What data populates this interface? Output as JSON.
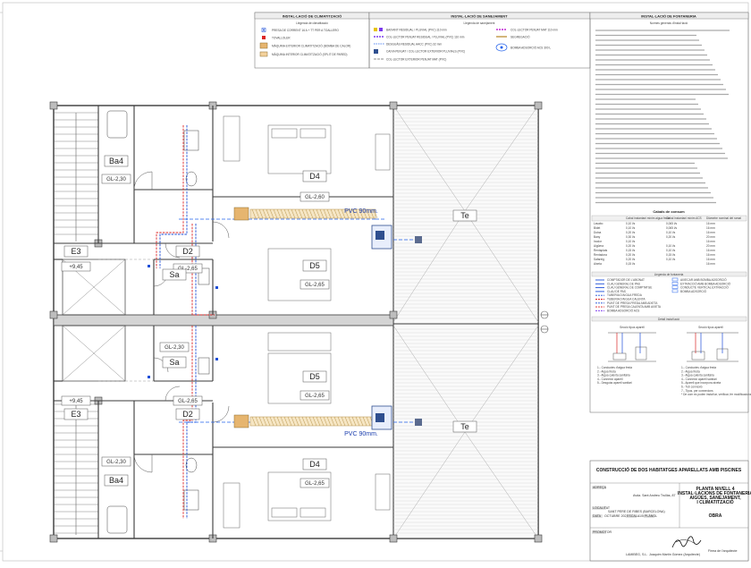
{
  "legend_panels": {
    "climate": {
      "title": "INSTAL·LACIÓ DE CLIMATITZACIÓ",
      "subtitle": "Llegenda de climatització",
      "items": [
        "PRESA DE CORRENT 16 A + TT PER A TOALLERO",
        "TOVALLOLER",
        "MÀQUINA EXTERIOR CLIMATITZACIÓ (BOMBA DE CALOR)",
        "MÀQUINA INTERIOR CLIMATITZACIÓ (SPLIT DE PARED)"
      ]
    },
    "sanitation": {
      "title": "INSTAL·LACIÓ DE SANEJAMENT",
      "subtitle": "Llegenda de sanejament",
      "items_left": [
        "BAIXANT RESIDUAL / PLUVIAL (PVC) 110 mm",
        "COL·LECTOR PENJAT RESIDUAL / PLUVIAL (PVC) 110 mm",
        "DESGUÀS RESIDUAL AACC (PVC) 32 mm",
        "CAIXA PENJAT / COL·LECTOR EXTERIOR PLUVIALS (PVC)",
        "COL·LECTOR EXTERIOR PENJAT MAT (PVC)"
      ],
      "items_right": [
        "COL·LECTOR PENJAT MAT 110 mm",
        "SEGREGACIÓ",
        "BOMBA ADSORCIÓ ACS 300 L"
      ]
    },
    "plumbing": {
      "title": "INSTAL·LACIÓ DE FONTANERIA",
      "subtitle": "Normes generals d'instal·lació",
      "flow_title": "Cabals de consum",
      "flow_headers": [
        "",
        "Cabal instantani mínim aigua freda",
        "Cabal instantani mínim ACS",
        "Diàmetre nominal del ramal"
      ],
      "flow_rows": [
        [
          "Lavabo",
          "0,10 l/s",
          "0,065 l/s",
          "16 mm"
        ],
        [
          "Bidet",
          "0,10 l/s",
          "0,065 l/s",
          "16 mm"
        ],
        [
          "Dutxa",
          "0,20 l/s",
          "0,10 l/s",
          "16 mm"
        ],
        [
          "Bany",
          "0,30 l/s",
          "0,20 l/s",
          "20 mm"
        ],
        [
          "Inodor",
          "0,10 l/s",
          "",
          "16 mm"
        ],
        [
          "Aigüera",
          "0,20 l/s",
          "0,10 l/s",
          "20 mm"
        ],
        [
          "Rentaplats",
          "0,15 l/s",
          "0,10 l/s",
          "16 mm"
        ],
        [
          "Rentadora",
          "0,20 l/s",
          "0,15 l/s",
          "16 mm"
        ],
        [
          "Safareig",
          "0,20 l/s",
          "0,10 l/s",
          "16 mm"
        ],
        [
          "Aixeta",
          "0,15 l/s",
          "",
          "16 mm"
        ]
      ],
      "legend_title": "Llegenda de fontaneria",
      "legend_left": [
        "COMPTADOR DE L'ABONAT",
        "CLAU GENERAL DE PAS",
        "CLAU GENERAL DE COMPTATGE",
        "CLAU DE PAS",
        "TUBERIA D'AIGUA FREDA",
        "TUBERIA D'AIGUA CALENTA",
        "PUNT DE PRESA FREDA AMB AIXETA",
        "PUNT DE PRESA CALENTA AMB AIXETA",
        "BOMBA ADSORCIÓ ACS"
      ],
      "legend_right": [
        "AIXECAR AMB BOMBA ADSORCIÓ",
        "EXTRACCIÓ AMB BOMBA ADSORCIÓ",
        "CONDUCTE VERTICAL EXTRACCIÓ",
        "BOMBA ADSORCIÓ"
      ],
      "detail_title": "Detall instal·lació",
      "detail_left_title": "Secció tipus aparell",
      "detail_right_title": "Secció tipus aparell",
      "detail_notes_left": [
        "1.- Conductes d'aigua freda",
        "2.- Aigua freda",
        "3.- Aigua calenta sanitària",
        "4.- Connexió aparell",
        "5.- Desguàs aparell sanitari"
      ],
      "detail_notes_right": [
        "1.- Conductes d'aigua freda",
        "2.- Aigua freda",
        "3.- Aigua calenta sanitària",
        "4.- Connexió aparell sanitari",
        "5.- Aparell que incorpora aixeta",
        "6.- Tub connexió",
        "7.- Tipus, per connexions",
        "* De com es poden instal·lar, verificar, fer modificacions"
      ]
    }
  },
  "rooms": [
    {
      "code": "Ba4",
      "level": "GL-2,30"
    },
    {
      "code": "D4",
      "level": "GL-2,60"
    },
    {
      "code": "E3",
      "level": "+9,45"
    },
    {
      "code": "D2",
      "level": "GL-2,65"
    },
    {
      "code": "Sa",
      "level": ""
    },
    {
      "code": "D5",
      "level": "GL-2,65"
    },
    {
      "code": "Te",
      "level": ""
    },
    {
      "code": "Sa",
      "level": "GL-2,30"
    },
    {
      "code": "D5",
      "level": "GL-2,65"
    },
    {
      "code": "E3",
      "level": "+9,45"
    },
    {
      "code": "D2",
      "level": "GL-2,65"
    },
    {
      "code": "Ba4",
      "level": "GL-2,30"
    },
    {
      "code": "D4",
      "level": "GL-2,65"
    },
    {
      "code": "Te",
      "level": ""
    }
  ],
  "pipe_labels": [
    "PVC 90mm.",
    "PVC 90mm."
  ],
  "title_block": {
    "project": "CONSTRUCCIÓ DE DOS HABITATGES APARELLATS AMB PISCINES",
    "address_label": "ADREÇA",
    "address": "Avda. Sant Andreu Trullàs, 87",
    "location_label": "LOCALITAT",
    "location": "SANT PERE DE RIBES (BARCELONA)",
    "date_label": "DATA",
    "date": "OCTUBRE 2021",
    "scale_label": "ESCALA",
    "scale": "1/50",
    "drawing_title": "PLANTA NIVELL 4\nINSTAL·LACIONS DE FONTANERIA\nAIGÜES, SANEJAMENT,\nI CLIMATITZACIÓ",
    "drawing_no_label": "PLÀNOL",
    "work_label": "OBRA",
    "developer_label": "PROMOTOR",
    "developer": "LAMIBEG, S.L.",
    "architect_label": "ARQUITECTE",
    "architect": "Joaquim Martín Gómez (Arquitecte)",
    "signature_label": "Firma de l'arquitecte"
  },
  "colors": {
    "cold_water": "#1d4ed8",
    "hot_water": "#dc2626",
    "drain": "#7c3aed",
    "pipe_hatch": "#c8a35a",
    "wall": "#3a3a3a",
    "terrace_line": "#9ca3af"
  }
}
